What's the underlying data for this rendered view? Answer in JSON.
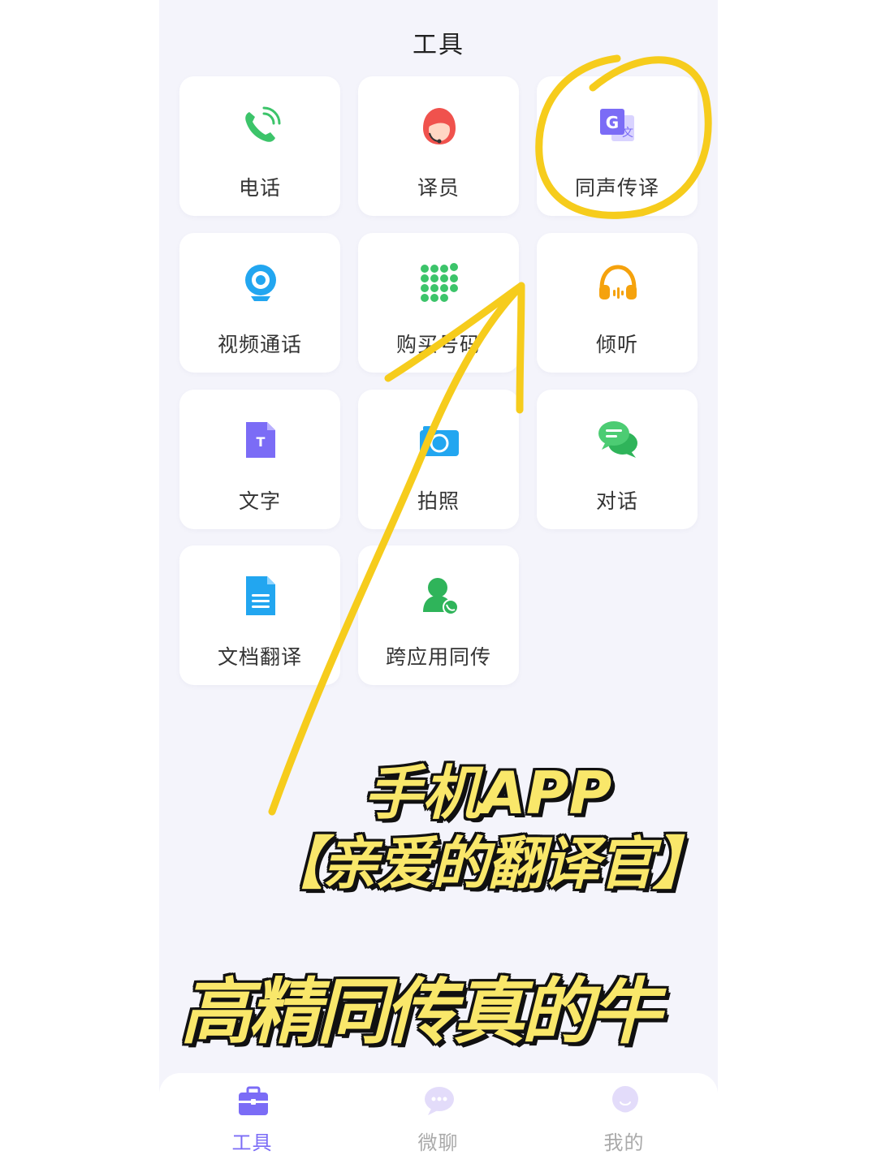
{
  "header": {
    "title": "工具"
  },
  "tools": [
    {
      "label": "电话",
      "icon": "phone-icon"
    },
    {
      "label": "译员",
      "icon": "interpreter-icon"
    },
    {
      "label": "同声传译",
      "icon": "translate-icon"
    },
    {
      "label": "视频通话",
      "icon": "video-call-icon"
    },
    {
      "label": "购买号码",
      "icon": "dialpad-icon"
    },
    {
      "label": "倾听",
      "icon": "headphones-icon"
    },
    {
      "label": "文字",
      "icon": "text-icon"
    },
    {
      "label": "拍照",
      "icon": "camera-icon"
    },
    {
      "label": "对话",
      "icon": "chat-icon"
    },
    {
      "label": "文档翻译",
      "icon": "document-icon"
    },
    {
      "label": "跨应用同传",
      "icon": "cross-app-icon"
    }
  ],
  "annotations": {
    "line1": "手机APP",
    "line2": "【亲爱的翻译官】",
    "line3": "高精同传真的牛",
    "highlight_color": "#f6cc1c"
  },
  "tabbar": {
    "items": [
      {
        "label": "工具",
        "icon": "toolbox-icon",
        "active": true
      },
      {
        "label": "微聊",
        "icon": "chat-bubble-icon",
        "active": false
      },
      {
        "label": "我的",
        "icon": "profile-icon",
        "active": false
      }
    ]
  },
  "colors": {
    "accent": "#7b6cf6",
    "background": "#f4f4fb",
    "tile": "#ffffff"
  }
}
